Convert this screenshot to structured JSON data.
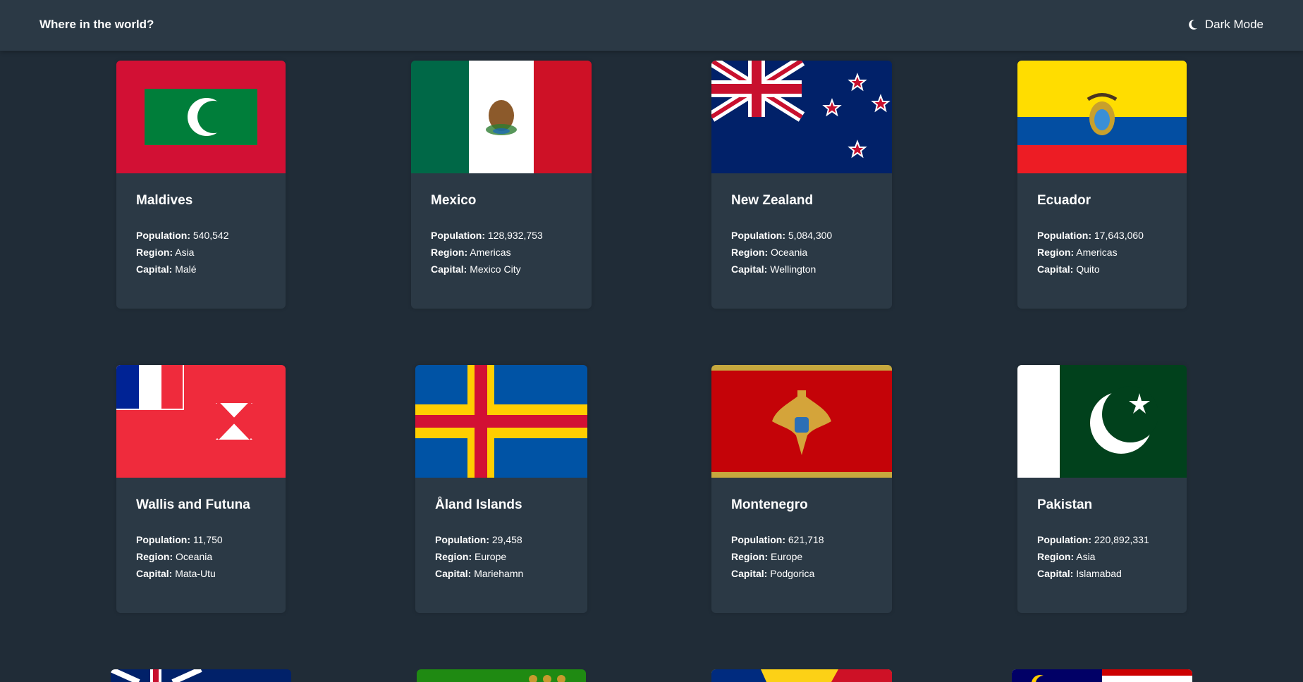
{
  "header": {
    "title": "Where in the world?",
    "mode_label": "Dark Mode",
    "mode_icon": "moon-icon"
  },
  "labels": {
    "population": "Population:",
    "region": "Region:",
    "capital": "Capital:"
  },
  "countries": [
    {
      "name": "Maldives",
      "population": "540,542",
      "region": "Asia",
      "capital": "Malé",
      "flag": "maldives-flag"
    },
    {
      "name": "Mexico",
      "population": "128,932,753",
      "region": "Americas",
      "capital": "Mexico City",
      "flag": "mexico-flag"
    },
    {
      "name": "New Zealand",
      "population": "5,084,300",
      "region": "Oceania",
      "capital": "Wellington",
      "flag": "new-zealand-flag"
    },
    {
      "name": "Ecuador",
      "population": "17,643,060",
      "region": "Americas",
      "capital": "Quito",
      "flag": "ecuador-flag"
    },
    {
      "name": "Wallis and Futuna",
      "population": "11,750",
      "region": "Oceania",
      "capital": "Mata-Utu",
      "flag": "wallis-and-futuna-flag"
    },
    {
      "name": "Åland Islands",
      "population": "29,458",
      "region": "Europe",
      "capital": "Mariehamn",
      "flag": "aland-islands-flag"
    },
    {
      "name": "Montenegro",
      "population": "621,718",
      "region": "Europe",
      "capital": "Podgorica",
      "flag": "montenegro-flag"
    },
    {
      "name": "Pakistan",
      "population": "220,892,331",
      "region": "Asia",
      "capital": "Islamabad",
      "flag": "pakistan-flag"
    }
  ],
  "colors": {
    "background": "#202c37",
    "elements": "#2b3945",
    "text": "#ffffff"
  }
}
